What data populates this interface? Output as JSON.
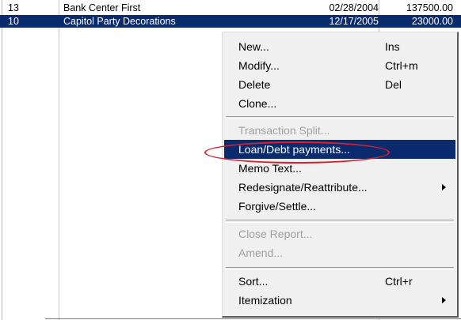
{
  "rows": [
    {
      "id": "13",
      "name": "Bank Center First",
      "date": "02/28/2004",
      "amount": "137500.00"
    },
    {
      "id": "10",
      "name": "Capitol Party Decorations",
      "date": "12/17/2005",
      "amount": "23000.00"
    }
  ],
  "context_menu": {
    "items": {
      "new": {
        "label": "New...",
        "shortcut": "Ins"
      },
      "modify": {
        "label": "Modify...",
        "shortcut": "Ctrl+m"
      },
      "delete": {
        "label": "Delete",
        "shortcut": "Del"
      },
      "clone": {
        "label": "Clone..."
      },
      "transaction_split": {
        "label": "Transaction Split..."
      },
      "loan_debt_payments": {
        "label": "Loan/Debt payments..."
      },
      "memo_text": {
        "label": "Memo Text..."
      },
      "redesignate": {
        "label": "Redesignate/Reattribute..."
      },
      "forgive_settle": {
        "label": "Forgive/Settle..."
      },
      "close_report": {
        "label": "Close Report..."
      },
      "amend": {
        "label": "Amend..."
      },
      "sort": {
        "label": "Sort...",
        "shortcut": "Ctrl+r"
      },
      "itemization": {
        "label": "Itemization"
      }
    }
  },
  "colors": {
    "selection": "#0a2b6e",
    "annotation_oval": "#d8202e"
  },
  "icons": {
    "submenu": "chevron-right-icon"
  }
}
